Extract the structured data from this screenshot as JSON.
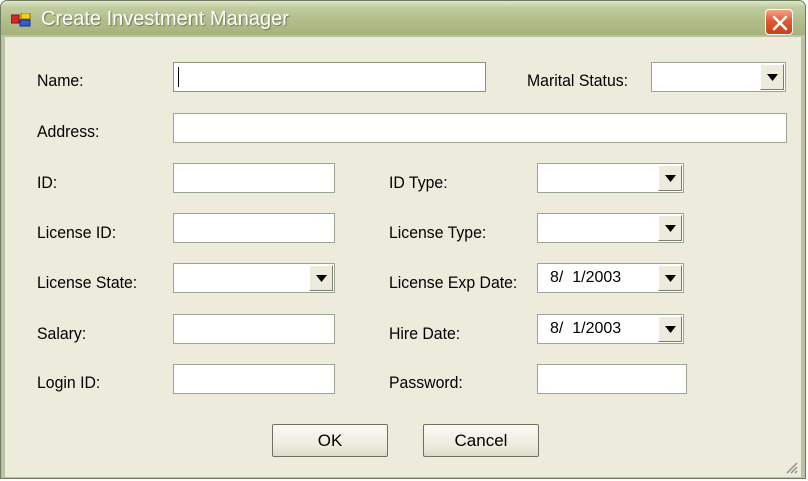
{
  "window": {
    "title": "Create Investment Manager"
  },
  "form": {
    "name": {
      "label": "Name:",
      "value": ""
    },
    "marital_status": {
      "label": "Marital Status:",
      "value": ""
    },
    "address": {
      "label": "Address:",
      "value": ""
    },
    "id": {
      "label": "ID:",
      "value": ""
    },
    "id_type": {
      "label": "ID Type:",
      "value": ""
    },
    "license_id": {
      "label": "License ID:",
      "value": ""
    },
    "license_type": {
      "label": "License Type:",
      "value": ""
    },
    "license_state": {
      "label": "License State:",
      "value": ""
    },
    "license_exp_date": {
      "label": "License Exp Date:",
      "value": "8/  1/2003"
    },
    "salary": {
      "label": "Salary:",
      "value": ""
    },
    "hire_date": {
      "label": "Hire Date:",
      "value": "8/  1/2003"
    },
    "login_id": {
      "label": "Login ID:",
      "value": ""
    },
    "password": {
      "label": "Password:",
      "value": ""
    }
  },
  "buttons": {
    "ok": "OK",
    "cancel": "Cancel"
  },
  "icons": {
    "app": "app-window-icon",
    "close": "close-icon",
    "dropdown": "chevron-down-icon",
    "grip": "resize-grip-icon"
  },
  "colors": {
    "titlebar": "#b2bf8c",
    "client": "#ecebdc",
    "close": "#e05a35"
  }
}
